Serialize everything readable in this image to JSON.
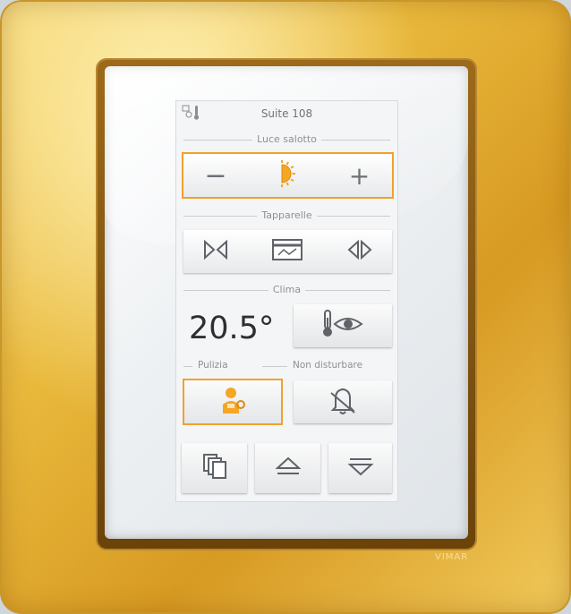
{
  "header": {
    "title": "Suite 108",
    "icon": "thermo-config-icon"
  },
  "light": {
    "label": "Luce salotto",
    "minus": "−",
    "plus": "+",
    "icon": "sun-icon",
    "selected": true
  },
  "blinds": {
    "label": "Tapparelle",
    "icons": [
      "blind-close-icon",
      "blind-scene-icon",
      "blind-open-icon"
    ]
  },
  "climate": {
    "label": "Clima",
    "temperature": "20.5°",
    "icon": "thermometer-eye-icon"
  },
  "cleaning": {
    "label": "Pulizia",
    "icon": "maid-icon",
    "selected": true
  },
  "dnd": {
    "label": "Non disturbare",
    "icon": "bell-muted-icon"
  },
  "footer": {
    "icons": [
      "pages-icon",
      "eject-up-icon",
      "down-arrow-icon"
    ]
  },
  "brand": "VIMAR",
  "colors": {
    "accent": "#f0a12f",
    "frame": "#e9b93c",
    "text": "#2c2f33"
  }
}
